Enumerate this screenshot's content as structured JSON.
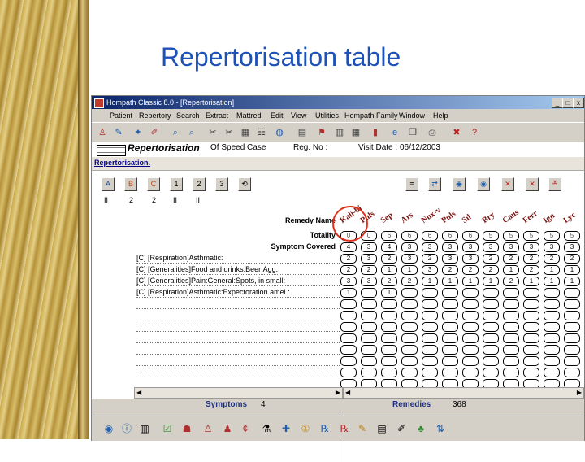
{
  "slide": {
    "title": "Repertorisation table"
  },
  "window": {
    "title": "Hompath Classic 8.0 - [Repertorisation]",
    "minimize": "_",
    "maximize": "□",
    "close": "x",
    "menu": [
      "Patient",
      "Repertory",
      "Search",
      "Extract",
      "Mattred",
      "Edit",
      "View",
      "Utilities",
      "Hompath Family",
      "Window",
      "Help"
    ]
  },
  "docbar": {
    "title": "Repertorisation",
    "case": "Of Speed Case",
    "reg": "Reg. No :",
    "visit": "Visit Date : 06/12/2003"
  },
  "subbar": {
    "title": "Repertorisation."
  },
  "left_buttons": [
    "A",
    "B",
    "C",
    "1",
    "2",
    "3",
    "⟲"
  ],
  "left_numbers": [
    "II",
    "2",
    "2",
    "II",
    "II"
  ],
  "right_buttons": [
    "≡",
    "⇄",
    "◉",
    "◉",
    "✕",
    "✕",
    "≚"
  ],
  "table": {
    "remedy_label": "Remedy Name",
    "totality_label": "Totality",
    "covered_label": "Symptom Covered",
    "remedies": [
      "Kali-bi",
      "Puls",
      "Sep",
      "Ars",
      "Nux-v",
      "Puls",
      "Sil",
      "Bry",
      "Caus",
      "Ferr",
      "Ign",
      "Lyc"
    ],
    "totality": [
      "0",
      "0",
      "6",
      "6",
      "6",
      "6",
      "6",
      "5",
      "5",
      "5",
      "5",
      "5"
    ],
    "covered": [
      "4",
      "3",
      "4",
      "3",
      "3",
      "3",
      "3",
      "3",
      "3",
      "3",
      "3",
      "3"
    ],
    "symptoms": [
      {
        "text": "[C] [Respiration]Asthmatic:",
        "values": [
          "2",
          "3",
          "2",
          "3",
          "2",
          "3",
          "3",
          "2",
          "2",
          "2",
          "2",
          "2"
        ]
      },
      {
        "text": "[C] [Generalities]Food and drinks:Beer:Agg.:",
        "values": [
          "2",
          "2",
          "1",
          "1",
          "3",
          "2",
          "2",
          "2",
          "1",
          "2",
          "1",
          "1"
        ]
      },
      {
        "text": "[C] [Generalities]Pain:General:Spots, in small:",
        "values": [
          "3",
          "3",
          "2",
          "2",
          "1",
          "1",
          "1",
          "1",
          "2",
          "1",
          "1",
          "1"
        ]
      },
      {
        "text": "[C] [Respiration]Asthmatic:Expectoration amel.:",
        "values": [
          "1",
          "",
          "1",
          "",
          "",
          "",
          "",
          "",
          "",
          "",
          "",
          ""
        ]
      }
    ],
    "empty_rows": 8
  },
  "status": {
    "symptoms_label": "Symptoms",
    "symptoms_value": "4",
    "remedies_label": "Remedies",
    "remedies_value": "368"
  },
  "colors": {
    "title": "#1c52b8",
    "titlebar": "#0a246a",
    "remedy": "#7a1010",
    "highlight": "#e0301e"
  }
}
